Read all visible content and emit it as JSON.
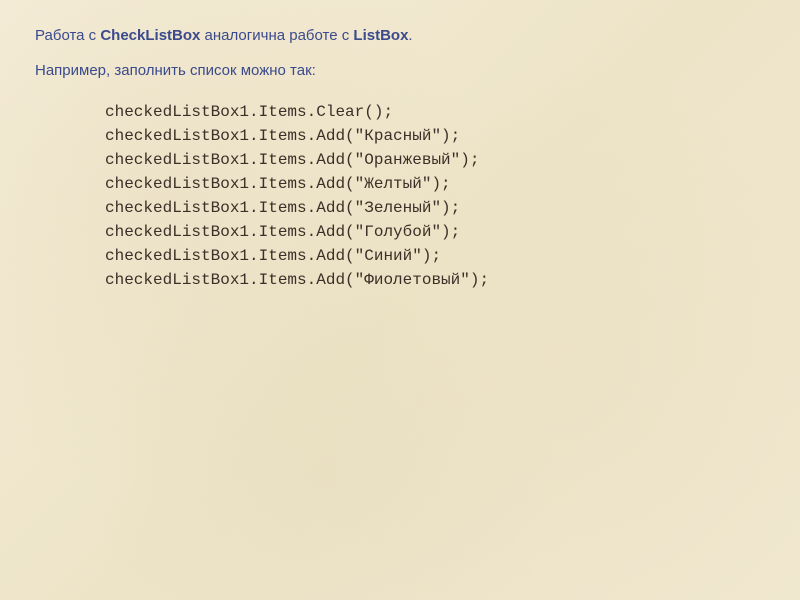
{
  "intro": {
    "part1": "Работа с ",
    "bold1": "CheckListBox",
    "part2": " аналогична работе с ",
    "bold2": "ListBox",
    "part3": "."
  },
  "subtext": "Например, заполнить список можно так:",
  "code_lines": [
    "checkedListBox1.Items.Clear();",
    "checkedListBox1.Items.Add(\"Красный\");",
    "checkedListBox1.Items.Add(\"Оранжевый\");",
    "checkedListBox1.Items.Add(\"Желтый\");",
    "checkedListBox1.Items.Add(\"Зеленый\");",
    "checkedListBox1.Items.Add(\"Голубой\");",
    "checkedListBox1.Items.Add(\"Синий\");",
    "checkedListBox1.Items.Add(\"Фиолетовый\");"
  ]
}
